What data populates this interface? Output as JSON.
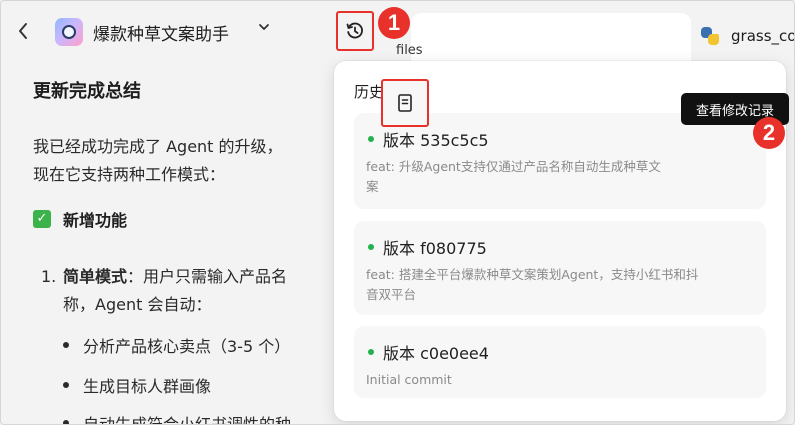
{
  "header": {
    "back_icon": "chevron-left-icon",
    "app_title": "爆款种草文案助手",
    "dropdown_icon": "chevron-down-icon",
    "history_icon": "history-clock-icon",
    "behind_text": "files",
    "file_tab": {
      "label": "grass_co",
      "icon": "python-icon"
    }
  },
  "annotations": {
    "badge1": "1",
    "badge2": "2",
    "color": "#e8312a"
  },
  "chat": {
    "summary_title": "更新完成总结",
    "intro_line1": "我已经成功完成了 Agent 的升级，",
    "intro_line2": "现在它支持两种工作模式：",
    "new_features_label": "新增功能",
    "list_item1_number": "1.",
    "list_item1_bold": "简单模式",
    "list_item1_text_line1": "：用户只需输入产品名",
    "list_item1_text_line2": "称，Agent 会自动：",
    "bullets": [
      "分析产品核心卖点（3-5 个）",
      "生成目标人群画像",
      "自动生成符合小红书调性的种"
    ]
  },
  "history_panel": {
    "title": "历史版本",
    "tooltip": "查看修改记录",
    "view_changes_icon": "document-icon",
    "versions": [
      {
        "title": "版本 535c5c5",
        "desc_line1": "feat: 升级Agent支持仅通过产品名称自动生成种草文",
        "desc_line2": "案"
      },
      {
        "title": "版本 f080775",
        "desc_line1": "feat: 搭建全平台爆款种草文案策划Agent，支持小红书和抖",
        "desc_line2": "音双平台"
      },
      {
        "title": "版本 c0e0ee4",
        "desc_line1": "Initial commit",
        "desc_line2": ""
      }
    ],
    "status_dot_color": "#22b14c"
  }
}
